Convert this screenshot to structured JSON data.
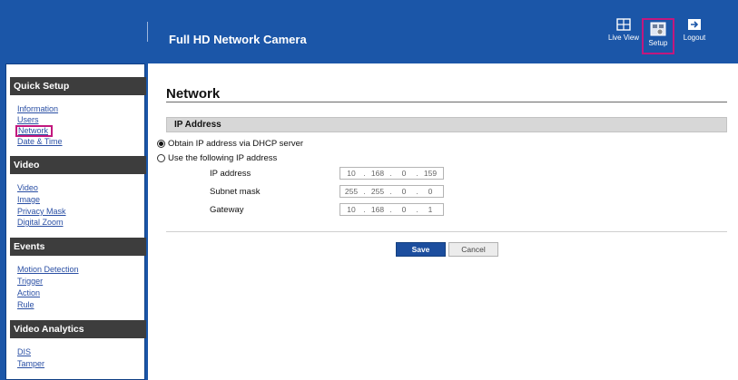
{
  "header": {
    "title": "Full HD Network Camera",
    "nav": [
      {
        "label": "Live View",
        "icon": "live-view-icon"
      },
      {
        "label": "Setup",
        "icon": "setup-icon"
      },
      {
        "label": "Logout",
        "icon": "logout-icon"
      }
    ],
    "colors": {
      "bar": "#1b56a8",
      "active_highlight": "#c2187e"
    }
  },
  "sidebar": {
    "sections": [
      {
        "title": "Quick Setup",
        "items": [
          "Information",
          "Users",
          "Network",
          "Date & Time"
        ]
      },
      {
        "title": "Video",
        "items": [
          "Video",
          "Image",
          "Privacy Mask",
          "Digital Zoom"
        ]
      },
      {
        "title": "Events",
        "items": [
          "Motion Detection",
          "Trigger",
          "Action",
          "Rule"
        ]
      },
      {
        "title": "Video Analytics",
        "items": [
          "DIS",
          "Tamper"
        ]
      }
    ],
    "active_item": "Network"
  },
  "main": {
    "title": "Network",
    "section_title": "IP Address",
    "options": {
      "dhcp": "Obtain IP address via DHCP server",
      "static": "Use the following IP address",
      "selected": "dhcp"
    },
    "fields": [
      {
        "label": "IP address",
        "octets": [
          "10",
          "168",
          "0",
          "159"
        ]
      },
      {
        "label": "Subnet mask",
        "octets": [
          "255",
          "255",
          "0",
          "0"
        ]
      },
      {
        "label": "Gateway",
        "octets": [
          "10",
          "168",
          "0",
          "1"
        ]
      }
    ],
    "buttons": {
      "save": "Save",
      "cancel": "Cancel"
    }
  }
}
